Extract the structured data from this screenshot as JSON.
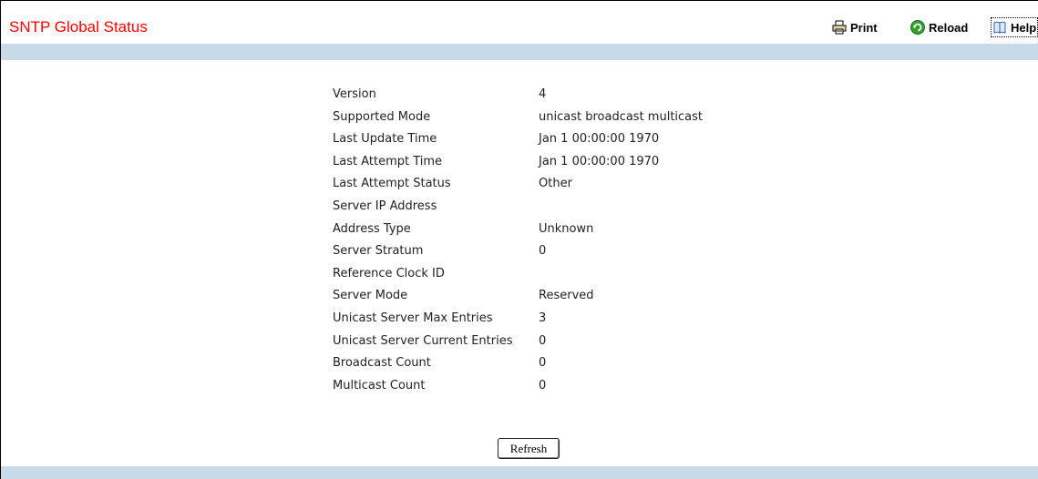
{
  "header": {
    "title": "SNTP Global Status",
    "print_label": "Print",
    "reload_label": "Reload",
    "help_label": "Help"
  },
  "status": [
    {
      "label": "Version",
      "value": "4"
    },
    {
      "label": "Supported Mode",
      "value": "unicast broadcast multicast"
    },
    {
      "label": "Last Update Time",
      "value": "Jan 1 00:00:00 1970"
    },
    {
      "label": "Last Attempt Time",
      "value": "Jan 1 00:00:00 1970"
    },
    {
      "label": "Last Attempt Status",
      "value": "Other"
    },
    {
      "label": "Server IP Address",
      "value": ""
    },
    {
      "label": "Address Type",
      "value": "Unknown"
    },
    {
      "label": "Server Stratum",
      "value": "0"
    },
    {
      "label": "Reference Clock ID",
      "value": ""
    },
    {
      "label": "Server Mode",
      "value": "Reserved"
    },
    {
      "label": "Unicast Server Max Entries",
      "value": "3"
    },
    {
      "label": "Unicast Server Current Entries",
      "value": "0"
    },
    {
      "label": "Broadcast Count",
      "value": "0"
    },
    {
      "label": "Multicast Count",
      "value": "0"
    }
  ],
  "actions": {
    "refresh_label": "Refresh"
  },
  "colors": {
    "title": "#ff0000",
    "band": "#c8d9e8"
  },
  "icons": {
    "print": "printer-icon",
    "reload": "reload-icon",
    "help": "help-book-icon"
  }
}
